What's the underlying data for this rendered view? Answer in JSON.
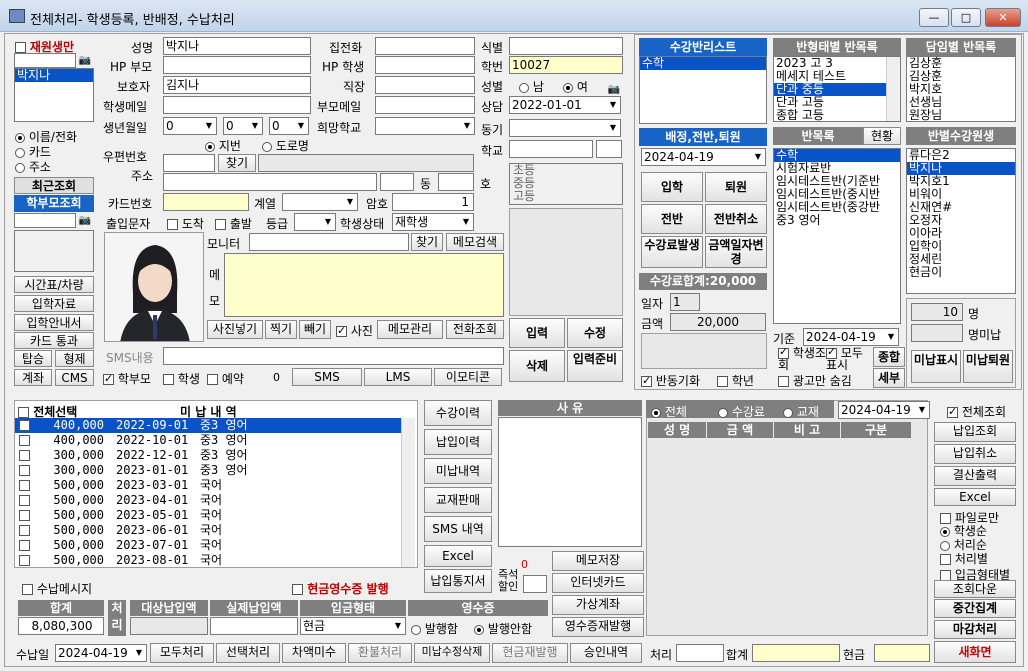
{
  "window": {
    "title": "전체처리- 학생등록, 반배정, 수납처리",
    "min": "—",
    "max": "□",
    "close": "✕"
  },
  "left": {
    "reenroll_label": "재원생만",
    "selected_student": "박지나",
    "radio_name": "이름/전화",
    "radio_card": "카드",
    "radio_address": "주소",
    "recent_lookup": "최근조회",
    "parent_lookup": "학부모조회",
    "btns": [
      "시간표/차량",
      "입학자료",
      "입학안내서",
      "카드 통과",
      "탑승",
      "형제",
      "계좌",
      "CMS"
    ]
  },
  "form": {
    "name_label": "성명",
    "name": "박지나",
    "hp_parent_label": "HP 부모",
    "hp_parent": "",
    "guardian_label": "보호자",
    "guardian": "김지나",
    "email_label": "학생메일",
    "email": "",
    "birth_label": "생년월일",
    "birth_y": "0",
    "birth_m": "0",
    "birth_d": "0",
    "lunar": "지번",
    "solar": "도로명",
    "zip_label": "우편번호",
    "find": "찾기",
    "address_label": "주소",
    "dong": "동",
    "ho": "호",
    "cardno_label": "카드번호",
    "cardno": "",
    "series_label": "계열",
    "pw_label": "암호",
    "pw": "1",
    "attend_label": "출입문자",
    "in_label": "도착",
    "out_label": "출발",
    "grade_label": "등급",
    "status_label": "학생상태",
    "status": "재학생",
    "homephone_label": "집전화",
    "hp_student_label": "HP 학생",
    "job_label": "직장",
    "parent_email_label": "부모메일",
    "hope_school_label": "희망학교",
    "id_label": "식별",
    "student_no_label": "학번",
    "student_no": "10027",
    "gender_label": "성별",
    "male": "남",
    "female": "여",
    "consult_label": "상담",
    "consult_date": "2022-01-01",
    "motive_label": "동기",
    "school_label": "학교",
    "grades": [
      "초등",
      "중등",
      "고등"
    ],
    "monitor_label": "모니터",
    "find2": "찾기",
    "memo_search": "메모검색",
    "memo_label": "메모",
    "photo_in": "사진넣기",
    "photo_take": "찍기",
    "photo_out": "빼기",
    "photo_chk": "사진",
    "memo_manage": "메모관리",
    "phone_lookup": "전화조회",
    "input": "입력",
    "edit": "수정",
    "delete": "삭제",
    "input_ready": "입력준비",
    "sms_label": "SMS내용",
    "parent_chk": "학부모",
    "student_chk": "학생",
    "reserve_chk": "예약",
    "count": "0",
    "sms": "SMS",
    "lms": "LMS",
    "emoticon": "이모티콘"
  },
  "class_panel": {
    "title": "수강반리스트",
    "items": [
      "수학"
    ],
    "assign_title": "배정,전반,퇴원",
    "date": "2024-04-19",
    "enter": "입학",
    "leave": "퇴원",
    "transfer": "전반",
    "transfer_cancel": "전반취소",
    "fee_issue": "수강료발생",
    "change_date": "금액일자변경",
    "fee_total": "수강료합계:20,000",
    "date_label": "일자",
    "date_val": "1",
    "amount_label": "금액",
    "amount": "20,000",
    "anti_sync": "반동기화",
    "grade_chk": "학년"
  },
  "type_panel": {
    "title": "반형태별 반목록",
    "items": [
      "2023 고 3",
      "메세지 테스트",
      "단과 중등",
      "단과 고등",
      "종합 고등"
    ]
  },
  "teacher_panel": {
    "title": "담임별 반목록",
    "items": [
      "김상훈",
      "김상훈",
      "박지호",
      "선생님",
      "원장님"
    ]
  },
  "class_list2": {
    "title": "반목록",
    "status": "현황",
    "items": [
      "수학",
      "시험자료반",
      "임시테스트반(기준반",
      "임시테스트반(중시반",
      "임시테스트반(중강반",
      "중3 영어"
    ]
  },
  "class_students": {
    "title": "반별수강원생",
    "items": [
      "류다은2",
      "박지나",
      "박지호1",
      "비워이",
      "신재연#",
      "오정자",
      "이아라",
      "입학이",
      "정세린",
      "현금이"
    ]
  },
  "right_bottom": {
    "base_label": "기준",
    "base_date": "2024-04-19",
    "student_lookup": "학생조회",
    "all_show": "모두표시",
    "hide_ad": "광고만 숨김",
    "total": "종합",
    "detail": "세부",
    "count": "10",
    "count_label": "명",
    "unpaid_label": "명미납",
    "unpaid_show": "미납표시",
    "unpaid_leave": "미납퇴원"
  },
  "unpaid": {
    "all_select": "전체선택",
    "header": "미 납 내 역",
    "rows": [
      {
        "amount": "400,000",
        "date": "2022-09-01",
        "course": "중3 영어"
      },
      {
        "amount": "400,000",
        "date": "2022-10-01",
        "course": "중3 영어"
      },
      {
        "amount": "300,000",
        "date": "2022-12-01",
        "course": "중3 영어"
      },
      {
        "amount": "300,000",
        "date": "2023-01-01",
        "course": "중3 영어"
      },
      {
        "amount": "500,000",
        "date": "2023-03-01",
        "course": "국어"
      },
      {
        "amount": "500,000",
        "date": "2023-04-01",
        "course": "국어"
      },
      {
        "amount": "500,000",
        "date": "2023-05-01",
        "course": "국어"
      },
      {
        "amount": "500,000",
        "date": "2023-06-01",
        "course": "국어"
      },
      {
        "amount": "500,000",
        "date": "2023-07-01",
        "course": "국어"
      },
      {
        "amount": "500,000",
        "date": "2023-08-01",
        "course": "국어"
      }
    ],
    "pay_msg": "수납메시지",
    "cash_receipt": "현금영수증 발행",
    "total_label": "합계",
    "total": "8,080,300",
    "process": "처리",
    "target_label": "대상납입액",
    "actual_label": "실제납입액",
    "method_label": "입금형태",
    "method": "현금",
    "receipt_label": "영수증",
    "issue": "발행함",
    "no_issue": "발행안함",
    "pay_date_label": "수납일",
    "pay_date": "2024-04-19",
    "bottom_btns": [
      "모두처리",
      "선택처리",
      "차액미수",
      "환불처리",
      "미납수정삭제",
      "현금재발행",
      "승인내역"
    ]
  },
  "mid_btns": {
    "list": [
      "수강이력",
      "납입이력",
      "미납내역",
      "교재판매",
      "SMS 내역",
      "Excel",
      "납입통지서"
    ],
    "reason": "사 유",
    "zero": "0",
    "instant_discount": "즉석할인",
    "memo_save": "메모저장",
    "internet_card": "인터넷카드",
    "virtual_account": "가상계좌",
    "receipt_issue": "영수증재발행"
  },
  "pay_lookup": {
    "all": "전체",
    "fee": "수강료",
    "book": "교재",
    "date": "2024-04-19",
    "all_lookup": "전체조회",
    "cols": [
      "성 명",
      "금 액",
      "비 고",
      "구분"
    ],
    "btns": [
      "납입조회",
      "납입취소",
      "결산출력",
      "Excel"
    ],
    "file_only": "파일로만",
    "student_order": "학생순",
    "process_order": "처리순",
    "process_by": "처리별",
    "pay_type_by": "입금형태별",
    "lookup_down": "조회다운",
    "mid_total": "중간집계",
    "close_process": "마감처리"
  },
  "footer": {
    "process_label": "처리",
    "sum_label": "합계",
    "cash_label": "현금",
    "new_screen": "새화면"
  }
}
